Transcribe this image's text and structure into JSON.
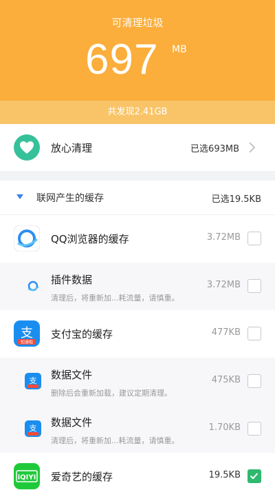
{
  "header": {
    "caption": "可清理垃圾",
    "amount": "697",
    "unit": "MB",
    "found": "共发现2.41GB"
  },
  "safe_clean": {
    "label": "放心清理",
    "value": "已选693MB"
  },
  "group": {
    "title": "联网产生的缓存",
    "value": "已选19.5KB",
    "items": [
      {
        "name": "QQ浏览器的缓存",
        "size": "3.72MB",
        "checked": false
      },
      {
        "name": "插件数据",
        "desc": "清理后，将重新加...耗流量，请慎重。",
        "size": "3.72MB",
        "checked": false
      },
      {
        "name": "支付宝的缓存",
        "size": "477KB",
        "checked": false
      },
      {
        "name": "数据文件",
        "desc": "删除后会重新加载，建议定期清理。",
        "size": "475KB",
        "checked": false
      },
      {
        "name": "数据文件",
        "desc": "清理后，将重新加...耗流量，请慎重。",
        "size": "1.70KB",
        "checked": false
      },
      {
        "name": "爱奇艺的缓存",
        "size": "19.5KB",
        "checked": true
      }
    ]
  },
  "icons": {
    "alipay_glyph": "支",
    "alipay_tag": "知道啦",
    "iqiyi_text": "iQIYI"
  },
  "colors": {
    "accent": "#fbae3c",
    "safe": "#36c19a",
    "checked": "#2fb86f",
    "link": "#3a80f2"
  }
}
